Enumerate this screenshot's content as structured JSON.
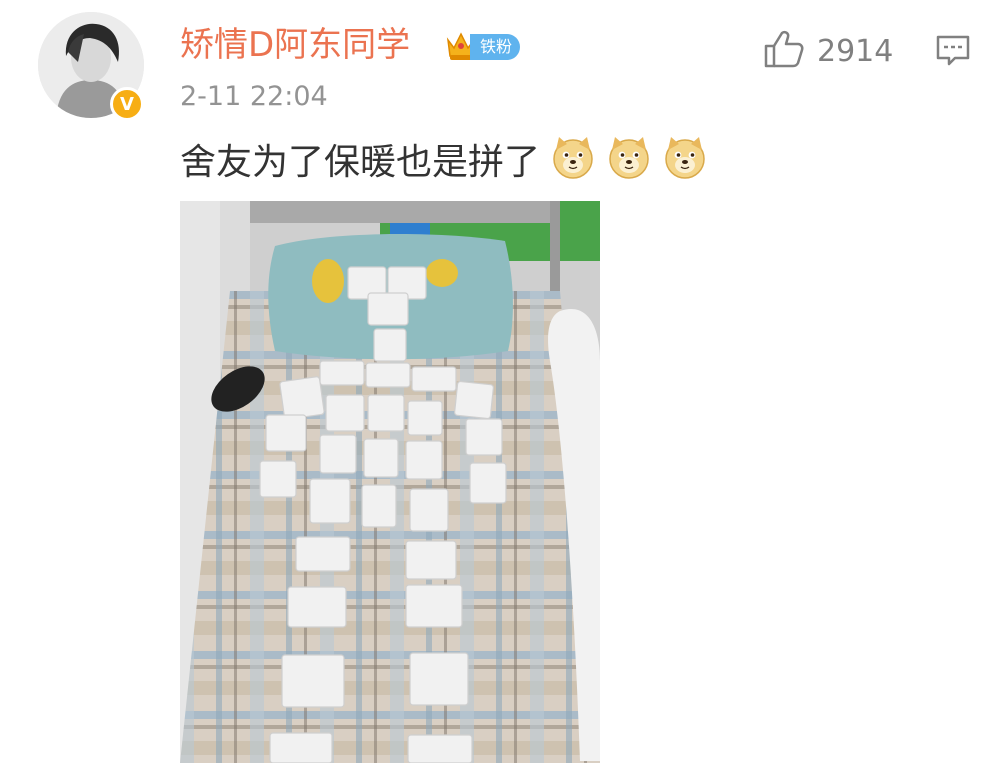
{
  "post": {
    "username": "矫情D阿东同学",
    "fan_badge": "铁粉",
    "timestamp": "2-11 22:04",
    "like_count": "2914",
    "text": "舍友为了保暖也是拼了",
    "emoji_count": 3,
    "verify_mark": "V"
  },
  "icons": {
    "like": "thumbs-up-icon",
    "comment": "comment-icon",
    "crown": "crown-icon",
    "emoji": "doge-emoji-icon"
  },
  "colors": {
    "username": "#eb7350",
    "timestamp": "#939393",
    "badge_blue": "#5fb3ee",
    "verify_gold": "#f7ae14"
  }
}
